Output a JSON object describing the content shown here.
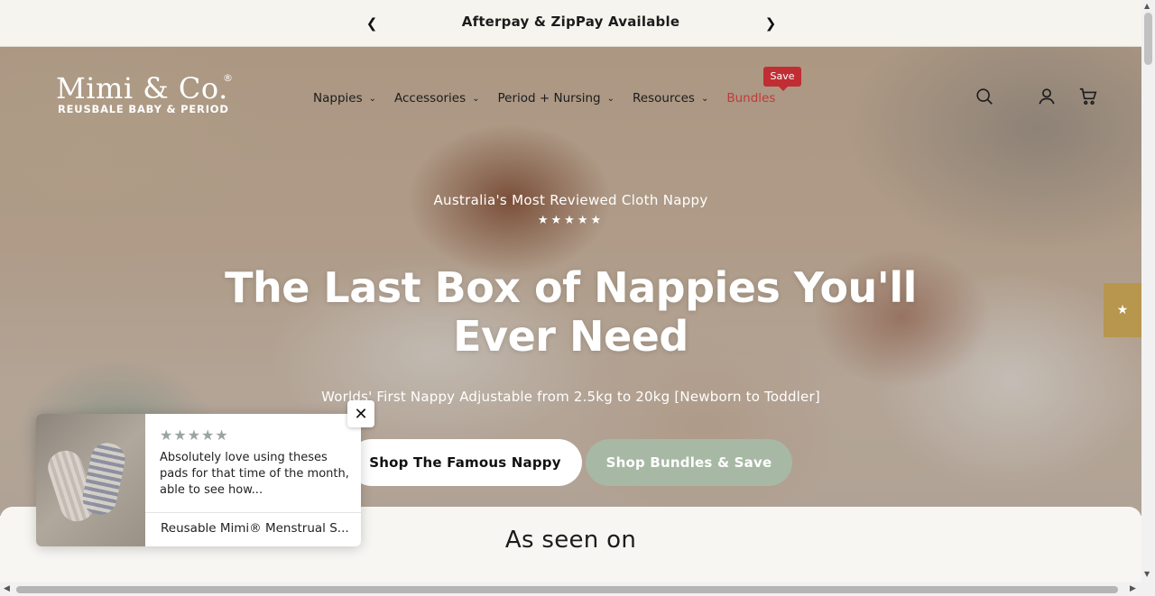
{
  "announcement": {
    "text": "Afterpay & ZipPay Available",
    "prev_icon": "chevron-left-icon",
    "next_icon": "chevron-right-icon"
  },
  "logo": {
    "name": "Mimi & Co.",
    "registered": "®",
    "tagline": "REUSBALE BABY & PERIOD"
  },
  "nav": {
    "items": [
      {
        "label": "Nappies",
        "has_dropdown": true
      },
      {
        "label": "Accessories",
        "has_dropdown": true
      },
      {
        "label": "Period + Nursing",
        "has_dropdown": true
      },
      {
        "label": "Resources",
        "has_dropdown": true
      },
      {
        "label": "Bundles",
        "has_dropdown": false
      }
    ],
    "bundles_badge": "Save",
    "bundles_color": "#c23a3a"
  },
  "header_icons": [
    "search-icon",
    "account-icon",
    "cart-icon"
  ],
  "hero": {
    "eyebrow": "Australia's Most Reviewed Cloth Nappy",
    "stars": "★★★★★",
    "headline_line1": "The Last Box of Nappies You'll",
    "headline_line2": "Ever Need",
    "subline": "Worlds' First Nappy Adjustable from 2.5kg to 20kg [Newborn to Toddler]",
    "primary_button": "Shop The Famous Nappy",
    "secondary_button": "Shop Bundles & Save",
    "secondary_color": "#a7b8a4"
  },
  "as_seen_on": {
    "title": "As seen on"
  },
  "review_popup": {
    "stars": "★★★★★",
    "review_text": "Absolutely love using theses pads for that time of the month, able to see how...",
    "product": "Reusable Mimi® Menstrual S...",
    "close_icon": "close-icon"
  },
  "reviews_tab": {
    "icon": "star-icon",
    "glyph": "★",
    "color": "#b7964d"
  }
}
